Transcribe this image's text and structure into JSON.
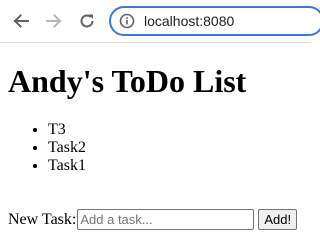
{
  "browser": {
    "url": "localhost:8080",
    "back_icon": "arrow-left",
    "forward_icon": "arrow-right",
    "reload_icon": "reload",
    "site_info_icon": "info-circle",
    "focus_color": "#3c78d8"
  },
  "page": {
    "title": "Andy's ToDo List",
    "tasks": [
      "T3",
      "Task2",
      "Task1"
    ],
    "new_task_label": "New Task:",
    "input_placeholder": "Add a task...",
    "input_value": "",
    "add_button_label": "Add!"
  }
}
